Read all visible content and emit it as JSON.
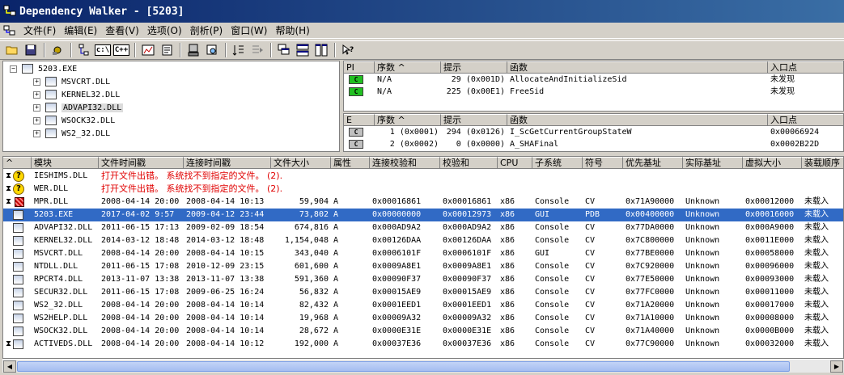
{
  "window": {
    "title": "Dependency Walker - [5203]"
  },
  "menu": [
    "文件(F)",
    "编辑(E)",
    "查看(V)",
    "选项(O)",
    "剖析(P)",
    "窗口(W)",
    "帮助(H)"
  ],
  "toolbar": {
    "c_drive_label": "c:\\",
    "cpp_label": "C++"
  },
  "tree": {
    "root": "5203.EXE",
    "children": [
      "MSVCRT.DLL",
      "KERNEL32.DLL",
      "ADVAPI32.DLL",
      "WSOCK32.DLL",
      "WS2_32.DLL"
    ]
  },
  "imports": {
    "headers": [
      "PI",
      "序数 ^",
      "提示",
      "函数",
      "入口点"
    ],
    "rows": [
      {
        "pi": "C",
        "ordinal": "N/A",
        "hint": "29 (0x001D)",
        "func": "AllocateAndInitializeSid",
        "entry": "未发现"
      },
      {
        "pi": "C",
        "ordinal": "N/A",
        "hint": "225 (0x00E1)",
        "func": "FreeSid",
        "entry": "未发现"
      }
    ]
  },
  "exports": {
    "headers": [
      "E",
      "序数 ^",
      "提示",
      "函数",
      "入口点"
    ],
    "rows": [
      {
        "e": "C",
        "ordinal": "1 (0x0001)",
        "hint": "294 (0x0126)",
        "func": "I_ScGetCurrentGroupStateW",
        "entry": "0x00066924"
      },
      {
        "e": "C",
        "ordinal": "2 (0x0002)",
        "hint": "0 (0x0000)",
        "func": "A_SHAFinal",
        "entry": "0x0002B22D"
      }
    ]
  },
  "modules": {
    "headers": [
      "^",
      "模块",
      "文件时间戳",
      "连接时间戳",
      "文件大小",
      "属性",
      "连接校验和",
      "校验和",
      "CPU",
      "子系统",
      "符号",
      "优先基址",
      "实际基址",
      "虚拟大小",
      "装载顺序"
    ],
    "error_rows": [
      {
        "name": "IESHIMS.DLL",
        "msg": "打开文件出错。 系统找不到指定的文件。 (2)."
      },
      {
        "name": "WER.DLL",
        "msg": "打开文件出错。 系统找不到指定的文件。 (2)."
      }
    ],
    "rows": [
      [
        "MPR.DLL",
        "2008-04-14 20:00",
        "2008-04-14 10:13",
        "59,904",
        "A",
        "0x00016861",
        "0x00016861",
        "x86",
        "Console",
        "CV",
        "0x71A90000",
        "Unknown",
        "0x00012000",
        "未载入"
      ],
      [
        "5203.EXE",
        "2017-04-02  9:57",
        "2009-04-12 23:44",
        "73,802",
        "A",
        "0x00000000",
        "0x00012973",
        "x86",
        "GUI",
        "PDB",
        "0x00400000",
        "Unknown",
        "0x00016000",
        "未载入"
      ],
      [
        "ADVAPI32.DLL",
        "2011-06-15 17:13",
        "2009-02-09 18:54",
        "674,816",
        "A",
        "0x000AD9A2",
        "0x000AD9A2",
        "x86",
        "Console",
        "CV",
        "0x77DA0000",
        "Unknown",
        "0x000A9000",
        "未载入"
      ],
      [
        "KERNEL32.DLL",
        "2014-03-12 18:48",
        "2014-03-12 18:48",
        "1,154,048",
        "A",
        "0x00126DAA",
        "0x00126DAA",
        "x86",
        "Console",
        "CV",
        "0x7C800000",
        "Unknown",
        "0x0011E000",
        "未载入"
      ],
      [
        "MSVCRT.DLL",
        "2008-04-14 20:00",
        "2008-04-14 10:15",
        "343,040",
        "A",
        "0x0006101F",
        "0x0006101F",
        "x86",
        "GUI",
        "CV",
        "0x77BE0000",
        "Unknown",
        "0x00058000",
        "未载入"
      ],
      [
        "NTDLL.DLL",
        "2011-06-15 17:08",
        "2010-12-09 23:15",
        "601,600",
        "A",
        "0x0009A8E1",
        "0x0009A8E1",
        "x86",
        "Console",
        "CV",
        "0x7C920000",
        "Unknown",
        "0x00096000",
        "未载入"
      ],
      [
        "RPCRT4.DLL",
        "2013-11-07 13:38",
        "2013-11-07 13:38",
        "591,360",
        "A",
        "0x00090F37",
        "0x00090F37",
        "x86",
        "Console",
        "CV",
        "0x77E50000",
        "Unknown",
        "0x00093000",
        "未载入"
      ],
      [
        "SECUR32.DLL",
        "2011-06-15 17:08",
        "2009-06-25 16:24",
        "56,832",
        "A",
        "0x00015AE9",
        "0x00015AE9",
        "x86",
        "Console",
        "CV",
        "0x77FC0000",
        "Unknown",
        "0x00011000",
        "未载入"
      ],
      [
        "WS2_32.DLL",
        "2008-04-14 20:00",
        "2008-04-14 10:14",
        "82,432",
        "A",
        "0x0001EED1",
        "0x0001EED1",
        "x86",
        "Console",
        "CV",
        "0x71A20000",
        "Unknown",
        "0x00017000",
        "未载入"
      ],
      [
        "WS2HELP.DLL",
        "2008-04-14 20:00",
        "2008-04-14 10:14",
        "19,968",
        "A",
        "0x00009A32",
        "0x00009A32",
        "x86",
        "Console",
        "CV",
        "0x71A10000",
        "Unknown",
        "0x00008000",
        "未载入"
      ],
      [
        "WSOCK32.DLL",
        "2008-04-14 20:00",
        "2008-04-14 10:14",
        "28,672",
        "A",
        "0x0000E31E",
        "0x0000E31E",
        "x86",
        "Console",
        "CV",
        "0x71A40000",
        "Unknown",
        "0x0000B000",
        "未载入"
      ],
      [
        "ACTIVEDS.DLL",
        "2008-04-14 20:00",
        "2008-04-14 10:12",
        "192,000",
        "A",
        "0x00037E36",
        "0x00037E36",
        "x86",
        "Console",
        "CV",
        "0x77C90000",
        "Unknown",
        "0x00032000",
        "未载入"
      ]
    ]
  }
}
